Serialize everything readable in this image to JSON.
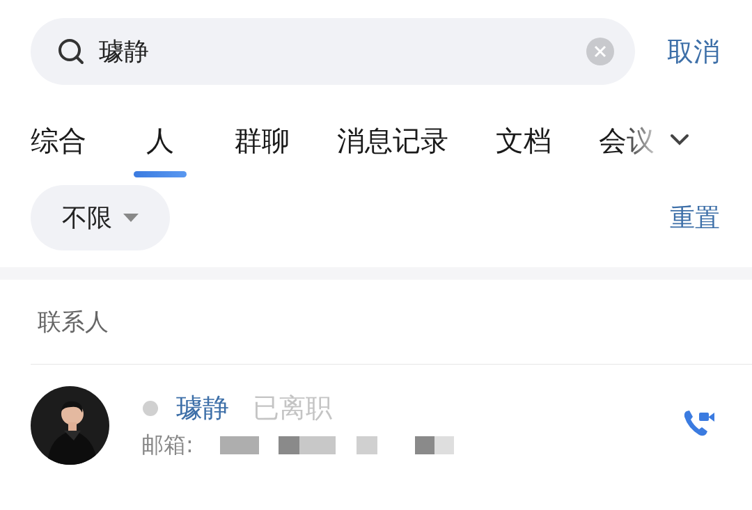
{
  "search": {
    "value": "璩静",
    "cancel": "取消"
  },
  "tabs": [
    {
      "label": "综合",
      "selected": false
    },
    {
      "label": "人",
      "selected": true
    },
    {
      "label": "群聊",
      "selected": false
    },
    {
      "label": "消息记录",
      "selected": false
    },
    {
      "label": "文档",
      "selected": false
    },
    {
      "label": "会议",
      "selected": false
    }
  ],
  "filter": {
    "label": "不限",
    "reset": "重置"
  },
  "section": {
    "title": "联系人"
  },
  "contacts": [
    {
      "online": false,
      "name": "璩静",
      "status": "已离职",
      "email_label": "邮箱:"
    }
  ]
}
